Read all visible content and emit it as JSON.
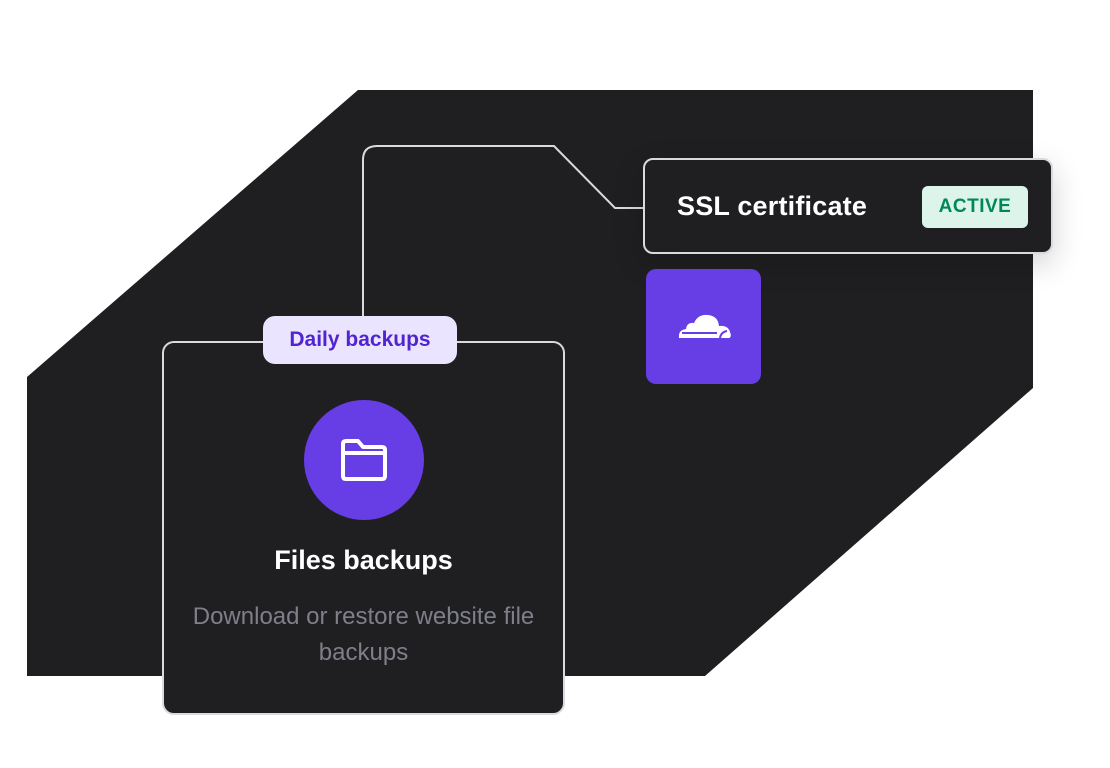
{
  "ssl": {
    "title": "SSL certificate",
    "status": "ACTIVE"
  },
  "cloud_tile": {
    "icon": "cloudflare-cloud-icon"
  },
  "backups_card": {
    "tag": "Daily backups",
    "icon": "folder-icon",
    "title": "Files backups",
    "description": "Download or restore website file backups"
  },
  "colors": {
    "background": "#ffffff",
    "shape": "#1f1f22",
    "card_border": "#d9d9de",
    "accent": "#673de6",
    "pill_bg": "#ebe4ff",
    "pill_text": "#5025d1",
    "active_bg": "#dcf4ea",
    "active_text": "#00875a",
    "muted_text": "#7f7f8a"
  }
}
